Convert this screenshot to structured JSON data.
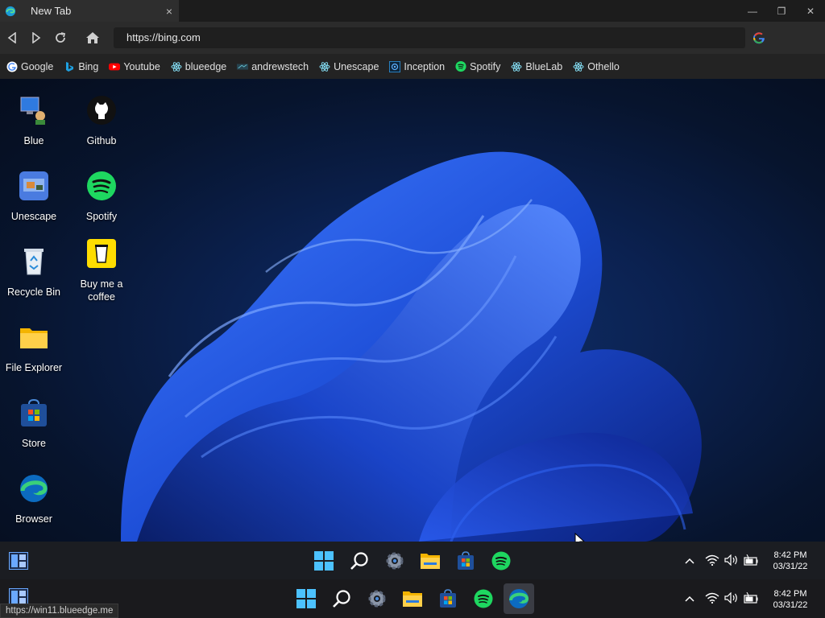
{
  "browser": {
    "tab_title": "New Tab",
    "tab_close": "×",
    "url": "https://bing.com",
    "status_url": "https://win11.blueedge.me",
    "controls": {
      "minimize": "—",
      "restore": "❐",
      "close": "✕"
    }
  },
  "bookmarks": [
    {
      "label": "Google",
      "icon": "google-icon"
    },
    {
      "label": "Bing",
      "icon": "bing-icon"
    },
    {
      "label": "Youtube",
      "icon": "youtube-icon"
    },
    {
      "label": "blueedge",
      "icon": "react-icon"
    },
    {
      "label": "andrewstech",
      "icon": "andrewstech-icon"
    },
    {
      "label": "Unescape",
      "icon": "react-icon"
    },
    {
      "label": "Inception",
      "icon": "inception-icon"
    },
    {
      "label": "Spotify",
      "icon": "spotify-icon"
    },
    {
      "label": "BlueLab",
      "icon": "react-icon"
    },
    {
      "label": "Othello",
      "icon": "react-icon"
    }
  ],
  "desktop_icons": [
    {
      "label": "Blue",
      "icon": "computer-icon"
    },
    {
      "label": "Github",
      "icon": "github-icon"
    },
    {
      "label": "Unescape",
      "icon": "unescape-icon"
    },
    {
      "label": "Spotify",
      "icon": "spotify-icon"
    },
    {
      "label": "Recycle Bin",
      "icon": "recycle-bin-icon"
    },
    {
      "label": "Buy me a coffee",
      "icon": "coffee-icon"
    },
    {
      "label": "File Explorer",
      "icon": "folder-icon"
    },
    {
      "label": "Store",
      "icon": "store-icon"
    },
    {
      "label": "Browser",
      "icon": "edge-icon"
    }
  ],
  "taskbar": {
    "time": "8:42 PM",
    "date": "03/31/22"
  },
  "colors": {
    "accent": "#0a84ff",
    "spotify": "#1ed760",
    "wallpaper": "#1e4fd8"
  }
}
